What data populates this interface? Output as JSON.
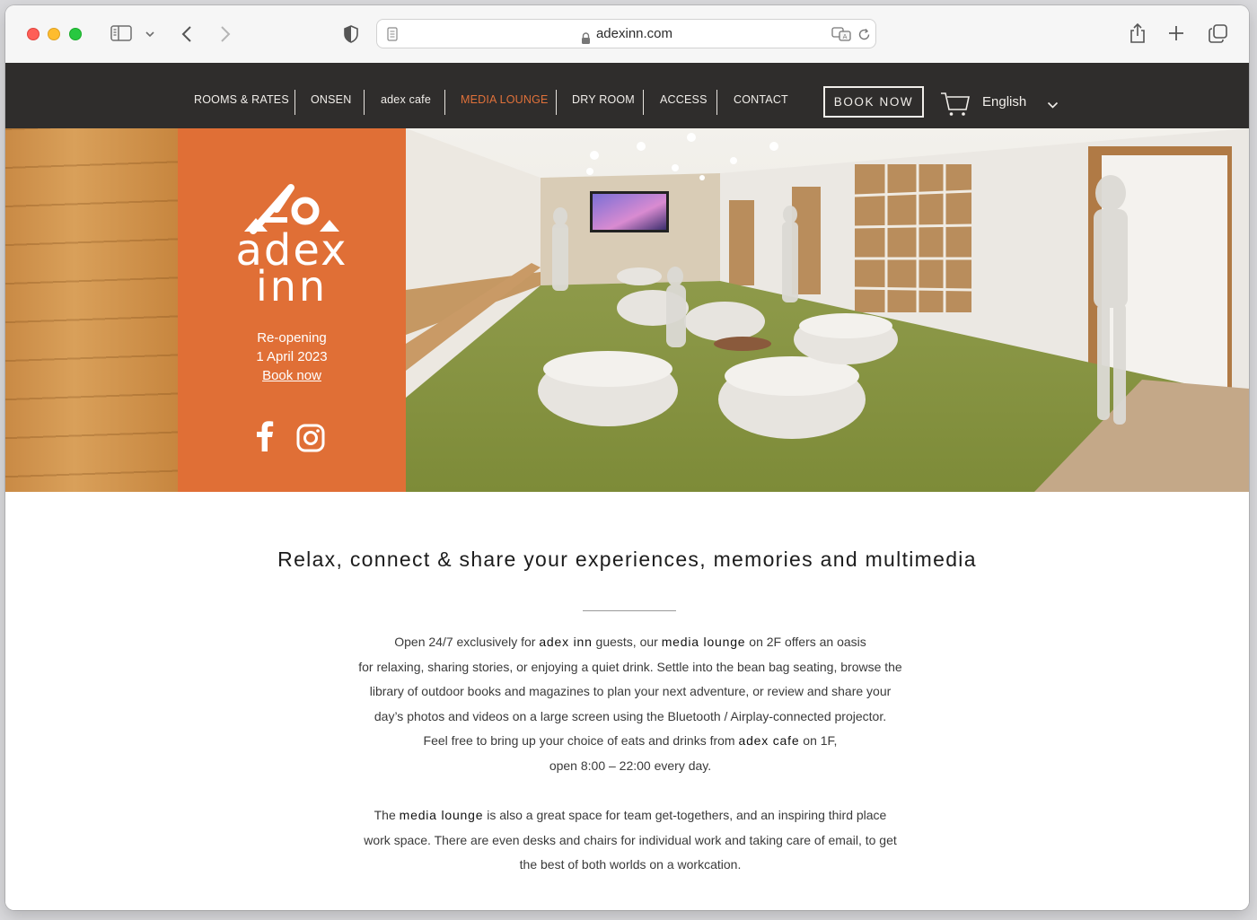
{
  "browser": {
    "url": "adexinn.com"
  },
  "nav": {
    "items": [
      {
        "label": "ROOMS & RATES",
        "active": false
      },
      {
        "label": "ONSEN",
        "active": false
      },
      {
        "label": "adex cafe",
        "active": false
      },
      {
        "label": "MEDIA LOUNGE",
        "active": true
      },
      {
        "label": "DRY ROOM",
        "active": false
      },
      {
        "label": "ACCESS",
        "active": false
      },
      {
        "label": "CONTACT",
        "active": false
      }
    ],
    "book_now": "BOOK NOW",
    "language": "English",
    "active_color": "#e0713a"
  },
  "hero": {
    "logo_line1": "adex",
    "logo_line2": "inn",
    "reopening": "Re-opening",
    "date": "1 April 2023",
    "book_link": "Book now",
    "brand_color": "#e06f36"
  },
  "content": {
    "headline": "Relax, connect & share your experiences, memories and multimedia",
    "p1": [
      {
        "t": "Open 24/7 exclusively for "
      },
      {
        "t": "adex inn",
        "b": true
      },
      {
        "t": " guests, our "
      },
      {
        "t": "media lounge",
        "b": true
      },
      {
        "t": " on 2F offers an oasis"
      },
      {
        "br": true
      },
      {
        "t": "for relaxing, sharing stories, or enjoying a quiet drink. Settle into the bean bag seating, browse the"
      },
      {
        "br": true
      },
      {
        "t": "library of outdoor books and magazines to plan your next adventure, or review and share your"
      },
      {
        "br": true
      },
      {
        "t": "day’s photos and videos on a large screen using the Bluetooth / Airplay-connected projector."
      },
      {
        "br": true
      },
      {
        "t": "Feel free to bring up your choice of eats and drinks from "
      },
      {
        "t": "adex cafe",
        "b": true
      },
      {
        "t": " on 1F,"
      },
      {
        "br": true
      },
      {
        "t": "open 8:00 – 22:00 every day."
      }
    ],
    "p2": [
      {
        "t": "The "
      },
      {
        "t": "media lounge",
        "b": true
      },
      {
        "t": " is also a great space for team get-togethers, and an inspiring third place"
      },
      {
        "br": true
      },
      {
        "t": "work space. There are even desks and chairs for individual work and taking care of email, to get"
      },
      {
        "br": true
      },
      {
        "t": "the best of both worlds on a workcation."
      }
    ]
  }
}
